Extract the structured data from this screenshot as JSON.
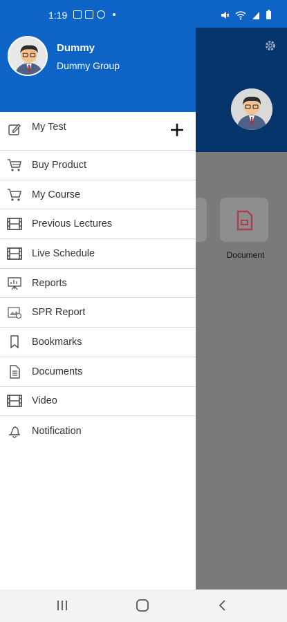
{
  "status_bar": {
    "time": "1:19"
  },
  "drawer": {
    "user": {
      "name": "Dummy",
      "group": "Dummy Group"
    },
    "items": [
      {
        "label": "My Test",
        "icon": "edit-icon"
      },
      {
        "label": "Buy Product",
        "icon": "cart-icon"
      },
      {
        "label": "My Course",
        "icon": "cart-icon"
      },
      {
        "label": "Previous Lectures",
        "icon": "film-icon"
      },
      {
        "label": "Live Schedule",
        "icon": "film-icon"
      },
      {
        "label": "Reports",
        "icon": "presentation-chart-icon"
      },
      {
        "label": "SPR Report",
        "icon": "report-image-icon"
      },
      {
        "label": "Bookmarks",
        "icon": "bookmark-icon"
      },
      {
        "label": "Documents",
        "icon": "document-icon"
      },
      {
        "label": "Video",
        "icon": "film-icon"
      },
      {
        "label": "Notification",
        "icon": "bell-icon"
      }
    ]
  },
  "background_app": {
    "document_label": "Document"
  },
  "colors": {
    "primary": "#0d64c6",
    "dark_header": "#06356c",
    "document_icon": "#d8435a"
  }
}
